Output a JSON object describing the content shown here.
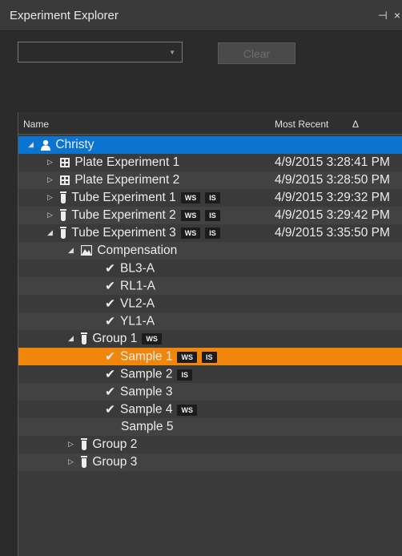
{
  "window": {
    "title": "Experiment Explorer",
    "pin": "⊣",
    "close": "×"
  },
  "toolbar": {
    "filter_value": "",
    "clear_label": "Clear"
  },
  "columns": {
    "name": "Name",
    "most_recent": "Most Recent",
    "sort_indicator": "Δ"
  },
  "colors": {
    "selection_blue": "#0a74d0",
    "selection_orange": "#f0860b",
    "badge_bg": "#1c1c1c"
  },
  "tree": [
    {
      "label": "Christy",
      "date": "",
      "icon": "user-icon",
      "expanded": true,
      "selected": "blue",
      "badges": []
    },
    {
      "label": "Plate Experiment 1",
      "date": "4/9/2015 3:28:41 PM",
      "icon": "plate-icon",
      "expanded": false,
      "badges": []
    },
    {
      "label": "Plate Experiment 2",
      "date": "4/9/2015 3:28:50 PM",
      "icon": "plate-icon",
      "expanded": false,
      "badges": []
    },
    {
      "label": "Tube Experiment 1",
      "date": "4/9/2015 3:29:32 PM",
      "icon": "tube-icon",
      "expanded": false,
      "badges": [
        "WS",
        "IS"
      ]
    },
    {
      "label": "Tube Experiment 2",
      "date": "4/9/2015 3:29:42 PM",
      "icon": "tube-icon",
      "expanded": false,
      "badges": [
        "WS",
        "IS"
      ]
    },
    {
      "label": "Tube Experiment 3",
      "date": "4/9/2015 3:35:50 PM",
      "icon": "tube-icon",
      "expanded": true,
      "badges": [
        "WS",
        "IS"
      ]
    },
    {
      "label": "Compensation",
      "date": "",
      "icon": "compensation-icon",
      "expanded": true,
      "badges": []
    },
    {
      "label": "BL3-A",
      "date": "",
      "icon": "check-icon",
      "badges": []
    },
    {
      "label": "RL1-A",
      "date": "",
      "icon": "check-icon",
      "badges": []
    },
    {
      "label": "VL2-A",
      "date": "",
      "icon": "check-icon",
      "badges": []
    },
    {
      "label": "YL1-A",
      "date": "",
      "icon": "check-icon",
      "badges": []
    },
    {
      "label": "Group 1",
      "date": "",
      "icon": "tube-icon",
      "expanded": true,
      "badges": [
        "WS"
      ]
    },
    {
      "label": "Sample 1",
      "date": "",
      "icon": "check-icon",
      "selected": "orange",
      "badges": [
        "WS",
        "IS"
      ]
    },
    {
      "label": "Sample 2",
      "date": "",
      "icon": "check-icon",
      "badges": [
        "IS"
      ]
    },
    {
      "label": "Sample 3",
      "date": "",
      "icon": "check-icon",
      "badges": []
    },
    {
      "label": "Sample 4",
      "date": "",
      "icon": "check-icon",
      "badges": [
        "WS"
      ]
    },
    {
      "label": "Sample 5",
      "date": "",
      "icon": "",
      "badges": []
    },
    {
      "label": "Group 2",
      "date": "",
      "icon": "tube-icon",
      "expanded": false,
      "badges": []
    },
    {
      "label": "Group 3",
      "date": "",
      "icon": "tube-icon",
      "expanded": false,
      "badges": []
    }
  ]
}
